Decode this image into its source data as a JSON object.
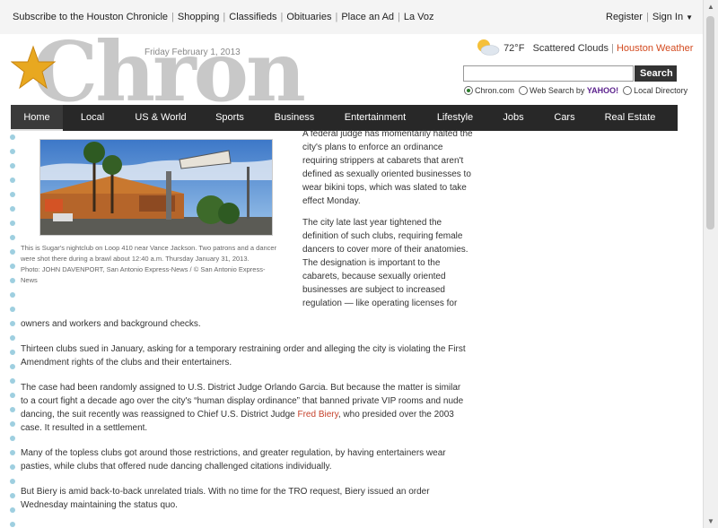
{
  "topbar": {
    "links": [
      "Subscribe to the Houston Chronicle",
      "Shopping",
      "Classifieds",
      "Obituaries",
      "Place an Ad",
      "La Voz"
    ],
    "register": "Register",
    "sign_in": "Sign In"
  },
  "masthead": {
    "logo_text": "Chron",
    "date": "Friday February 1, 2013",
    "weather": {
      "temp": "72°F",
      "condition": "Scattered Clouds",
      "location_link": "Houston Weather"
    },
    "search": {
      "value": "",
      "button": "Search",
      "options": [
        {
          "label": "Chron.com",
          "selected": true
        },
        {
          "label": "Web Search by",
          "brand": "YAHOO!",
          "selected": false
        },
        {
          "label": "Local Directory",
          "selected": false
        }
      ]
    }
  },
  "nav": {
    "items": [
      "Home",
      "Local",
      "US & World",
      "Sports",
      "Business",
      "Entertainment",
      "Lifestyle",
      "Jobs",
      "Cars",
      "Real Estate"
    ],
    "active": "Home"
  },
  "article": {
    "caption": "This is Sugar's nightclub on Loop 410 near Vance Jackson. Two patrons and a dancer were shot there during a brawl about 12:40 a.m. Thursday January 31, 2013.",
    "caption_credit": "Photo: JOHN DAVENPORT, San Antonio Express-News / © San Antonio Express-News",
    "side_paragraphs": [
      "A federal judge has momentarily halted the city's plans to enforce an ordinance requiring strippers at cabarets that aren't defined as sexually oriented businesses to wear bikini tops, which was slated to take effect Monday.",
      "The city late last year tightened the definition of such clubs, requiring female dancers to cover more of their anatomies. The designation is important to the cabarets, because sexually oriented businesses are subject to increased regulation — like operating licenses for"
    ],
    "continued": "owners and workers and background checks.",
    "p_thirteen": "Thirteen clubs sued in January, asking for a temporary restraining order and alleging the city is violating the First Amendment rights of the clubs and their entertainers.",
    "p_case_before": "The case had been randomly assigned to U.S. District Judge Orlando Garcia. But because the matter is similar to a court fight a decade ago over the city's “human display ordinance” that banned private VIP rooms and nude dancing, the suit recently was reassigned to Chief U.S. District Judge",
    "p_case_link": "Fred Biery",
    "p_case_after": ", who presided over the 2003 case. It resulted in a settlement.",
    "p_topless": "Many of the topless clubs got around those restrictions, and greater regulation, by having entertainers wear pasties, while clubs that offered nude dancing challenged citations individually.",
    "p_biery": "But Biery is amid back-to-back unrelated trials. With no time for the TRO request, Biery issued an order Wednesday maintaining the status quo."
  }
}
